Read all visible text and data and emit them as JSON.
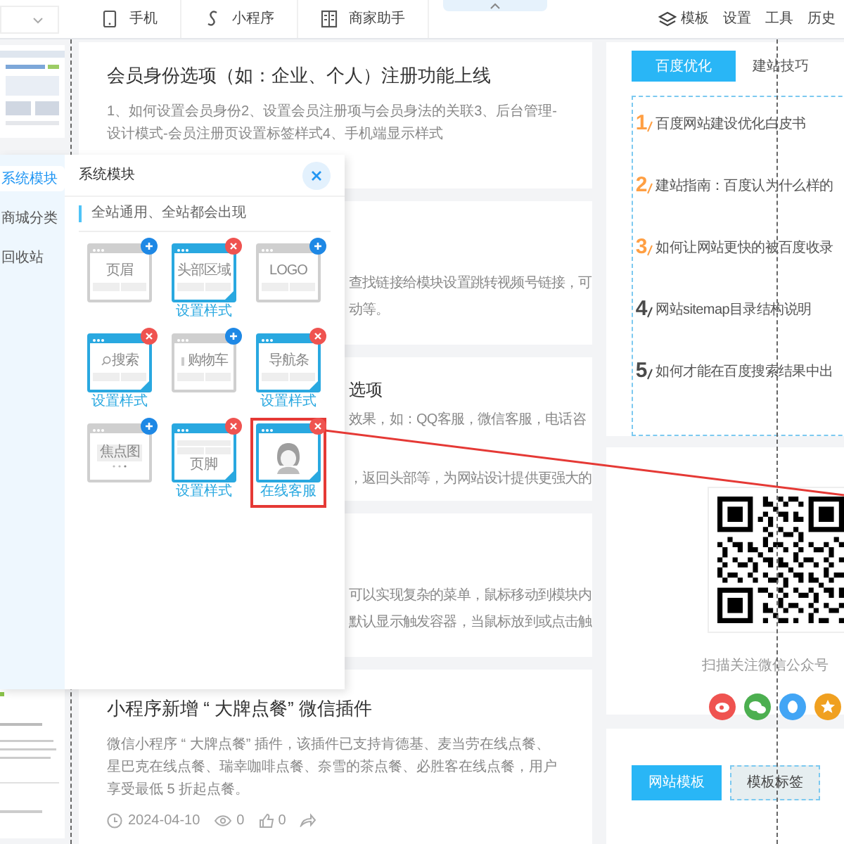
{
  "toolbar": {
    "nav": [
      {
        "label": "手机",
        "kind": "phone"
      },
      {
        "label": "小程序",
        "kind": "applet"
      },
      {
        "label": "商家助手",
        "kind": "book"
      }
    ],
    "actions": [
      {
        "label": "模板",
        "kind": "layers"
      },
      {
        "label": "设置",
        "kind": "text"
      },
      {
        "label": "工具",
        "kind": "text"
      },
      {
        "label": "历史",
        "kind": "text"
      }
    ]
  },
  "articles": [
    {
      "title": "会员身份选项（如：企业、个人）注册功能上线",
      "lines": [
        "1、如何设置会员身份2、设置会员注册项与会员身法的关联3、后台管理-设计模式-会员注册页设置标签样式4、手机端显示样式"
      ]
    },
    {
      "lines": [
        "查找链接给模块设置跳转视频号链接，可",
        "动等。"
      ]
    },
    {
      "title": "选项",
      "lines": [
        "效果，如：QQ客服，微信客服，电话咨",
        "，返回头部等，为网站设计提供更强大的"
      ]
    },
    {
      "lines": [
        "可以实现复杂的菜单，鼠标移动到模块内",
        "默认显示触发容器，当鼠标放到或点击触"
      ]
    },
    {
      "title": "小程序新增 “ 大牌点餐” 微信插件",
      "lines": [
        "微信小程序 “ 大牌点餐” 插件，该插件已支持肯德基、麦当劳在线点餐、星巴克在线点餐、瑞幸咖啡点餐、奈雪的茶点餐、必胜客在线点餐，用户享受最低 5 折起点餐。"
      ],
      "meta": {
        "date": "2024-04-10",
        "views": "0",
        "likes": "0"
      }
    }
  ],
  "side_tabs": [
    {
      "label": "百度优化",
      "selected": true
    },
    {
      "label": "建站技巧",
      "selected": false
    }
  ],
  "side_list": [
    {
      "rank": "1",
      "text": "百度网站建设优化白皮书",
      "color": "#ff9f43"
    },
    {
      "rank": "2",
      "text": "建站指南：百度认为什么样的",
      "color": "#ff9f43"
    },
    {
      "rank": "3",
      "text": "如何让网站更快的被百度收录",
      "color": "#ff9f43"
    },
    {
      "rank": "4",
      "text": "网站sitemap目录结构说明",
      "color": "#4a4a4a"
    },
    {
      "rank": "5",
      "text": "如何才能在百度搜索结果中出",
      "color": "#4a4a4a"
    }
  ],
  "qr_caption": "扫描关注微信公众号",
  "social": [
    {
      "kind": "eye",
      "color": "#ef5350"
    },
    {
      "kind": "chat",
      "color": "#4caf50"
    },
    {
      "kind": "bubble",
      "color": "#42a5f5"
    },
    {
      "kind": "star",
      "color": "#f0a020"
    }
  ],
  "bottom_tabs": [
    {
      "label": "网站模板",
      "selected": true
    },
    {
      "label": "模板标签",
      "selected": false
    }
  ],
  "panel": {
    "nav": [
      {
        "label": "系统模块",
        "selected": true
      },
      {
        "label": "商城分类",
        "selected": false
      },
      {
        "label": "回收站",
        "selected": false
      }
    ],
    "title": "系统模块",
    "notice": "全站通用、全站都会出现",
    "modules": [
      {
        "kind": "plain",
        "label": "页眉",
        "added": false,
        "highlighted": false
      },
      {
        "kind": "plain",
        "label": "头部区域",
        "added": true,
        "link": "设置样式",
        "highlighted": false
      },
      {
        "kind": "plain",
        "label": "LOGO",
        "added": false,
        "highlighted": false
      },
      {
        "kind": "search",
        "label": "搜索",
        "added": true,
        "link": "设置样式",
        "highlighted": false
      },
      {
        "kind": "cart",
        "label": "购物车",
        "added": false,
        "highlighted": false
      },
      {
        "kind": "plain",
        "label": "导航条",
        "added": true,
        "link": "设置样式",
        "highlighted": false
      },
      {
        "kind": "slider",
        "label": "焦点图",
        "added": false,
        "highlighted": false
      },
      {
        "kind": "footer",
        "label": "页脚",
        "added": true,
        "link": "设置样式",
        "highlighted": false
      },
      {
        "kind": "avatar",
        "added": true,
        "link": "在线客服",
        "highlighted": true
      }
    ]
  }
}
